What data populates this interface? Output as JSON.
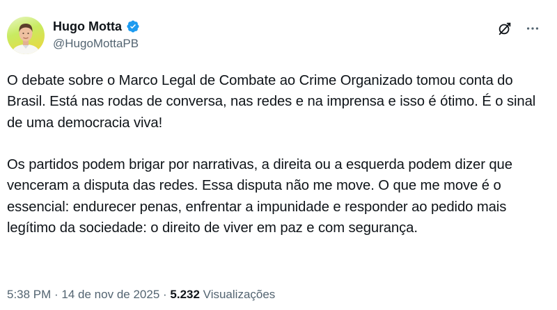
{
  "author": {
    "display_name": "Hugo Motta",
    "handle": "@HugoMottaPB",
    "verified": true
  },
  "icons": {
    "avatar": "profile-photo",
    "verified": "verified-badge-icon",
    "grok": "grok-icon",
    "more": "more-icon"
  },
  "colors": {
    "verified_blue": "#1d9bf0",
    "text_primary": "#0f1419",
    "text_secondary": "#536471"
  },
  "tweet": {
    "paragraphs": [
      "O debate sobre o Marco Legal de Combate ao Crime Organizado tomou conta do Brasil. Está nas rodas de conversa, nas redes e na imprensa e isso é ótimo. É o sinal de uma democracia viva!",
      "Os partidos podem brigar por narrativas, a direita ou a esquerda podem dizer que venceram a disputa das redes. Essa disputa não me move. O que me move é o essencial: endurecer penas, enfrentar a impunidade e responder ao pedido mais legítimo da sociedade: o direito de viver em paz e com segurança."
    ]
  },
  "meta": {
    "time": "5:38 PM",
    "date": "14 de nov de 2025",
    "separator": " · ",
    "views_count": "5.232",
    "views_label": "Visualizações"
  }
}
